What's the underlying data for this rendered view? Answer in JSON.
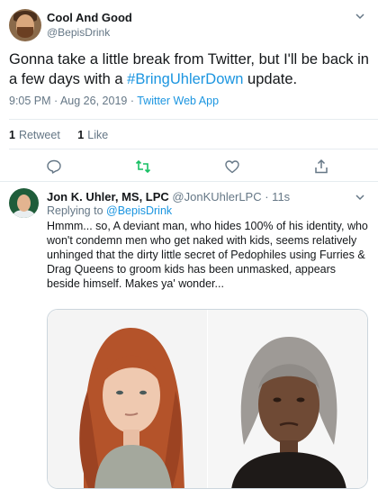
{
  "tweet": {
    "author_name": "Cool And Good",
    "author_handle": "@BepisDrink",
    "text_before": "Gonna take a little break from Twitter, but I'll be back in a few days with a ",
    "hashtag": "#BringUhlerDown",
    "text_after": " update.",
    "time_date": "9:05 PM · Aug 26, 2019 · ",
    "source": "Twitter Web App",
    "stats": {
      "retweets_count": "1",
      "retweets_label": "Retweet",
      "likes_count": "1",
      "likes_label": "Like"
    },
    "icons": [
      "reply-icon",
      "retweet-icon",
      "like-icon",
      "share-icon",
      "chevron-down-icon"
    ],
    "colors": {
      "link": "#1b95e0",
      "retweet_active": "#17bf63",
      "muted": "#657786"
    }
  },
  "reply": {
    "author_name": "Jon K. Uhler, MS, LPC",
    "author_handle": "@JonKUhlerLPC",
    "time": "· 11s",
    "replying_label": "Replying to ",
    "replying_handle": "@BepisDrink",
    "text": "Hmmm... so, A deviant man, who hides 100% of his identity, who won't condemn men who get naked with kids, seems relatively unhinged that the dirty little secret of Pedophiles using Furries & Drag Queens to groom kids has been unmasked, appears beside himself. Makes ya' wonder..."
  }
}
